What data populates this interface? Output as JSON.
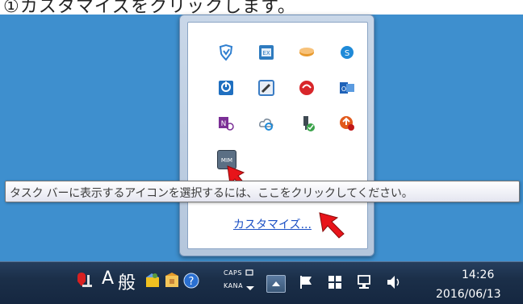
{
  "caption": {
    "text": "①カスタマイズをクリックします。"
  },
  "popup": {
    "icons": [
      {
        "name": "security-shield-icon",
        "color": "#2f7fd0"
      },
      {
        "name": "excel-addin-icon",
        "color": "#2e7bbf"
      },
      {
        "name": "cloud-sync-icon",
        "color": "#e89a2e"
      },
      {
        "name": "skype-icon",
        "color": "#1f8ad8"
      },
      {
        "name": "power-management-icon",
        "color": "#1f6fc0"
      },
      {
        "name": "wrench-tool-icon",
        "color": "#3a7cc4"
      },
      {
        "name": "red-circle-app-icon",
        "color": "#d8262a"
      },
      {
        "name": "outlook-icon",
        "color": "#1f62b8"
      },
      {
        "name": "onenote-icon",
        "color": "#7b2f96"
      },
      {
        "name": "cloud-refresh-icon",
        "color": "#7a8a9a"
      },
      {
        "name": "usb-safe-remove-icon",
        "color": "#3f4a52"
      },
      {
        "name": "update-error-icon",
        "color": "#e25a1c"
      },
      {
        "name": "ime-tool-icon",
        "color": "#5b6f84"
      }
    ],
    "ime_icon_text": "MIM",
    "customize_link": "カスタマイズ..."
  },
  "tooltip": {
    "text": "タスク バーに表示するアイコンを選択するには、ここをクリックしてください。"
  },
  "taskbar": {
    "ime_mode": "A",
    "ime_kanji": "般",
    "caps_label": "CAPS",
    "kana_label": "KANA",
    "time": "14:26",
    "date": "2016/06/13"
  }
}
